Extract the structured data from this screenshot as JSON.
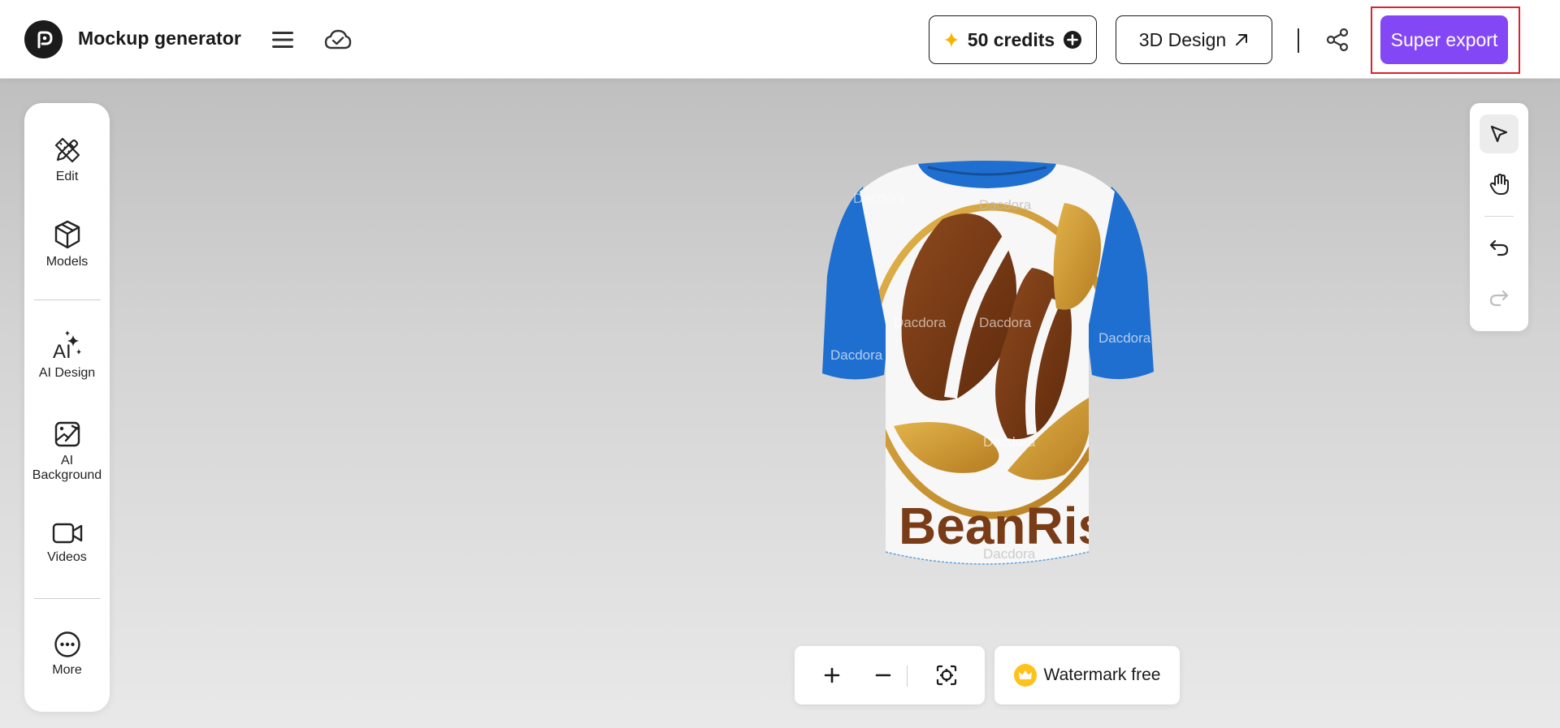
{
  "header": {
    "app_title": "Mockup generator",
    "credits_label": "50 credits",
    "design3d_label": "3D Design",
    "export_label": "Super export"
  },
  "sidebar": {
    "items": [
      {
        "label": "Edit",
        "icon": "pencil-ruler-icon"
      },
      {
        "label": "Models",
        "icon": "cube-icon"
      },
      {
        "label": "AI Design",
        "icon": "ai-sparkle-icon"
      },
      {
        "label": "AI Background",
        "icon": "image-edit-icon"
      },
      {
        "label": "Videos",
        "icon": "video-icon"
      },
      {
        "label": "More",
        "icon": "more-icon"
      }
    ]
  },
  "toolbar": {
    "tools": [
      "select-pointer-icon",
      "hand-icon",
      "undo-icon",
      "redo-icon"
    ]
  },
  "canvas": {
    "shirt_print_text": "BeanRis",
    "watermark_text": "Dacdora"
  },
  "bottom": {
    "watermark_free_label": "Watermark free"
  },
  "colors": {
    "accent": "#8447f6",
    "highlight": "#e0202a",
    "shirt_sleeve": "#1f6fd0",
    "coffee_brown": "#7a3c17",
    "gold": "#c9962e",
    "credit_star": "#f5b400"
  }
}
